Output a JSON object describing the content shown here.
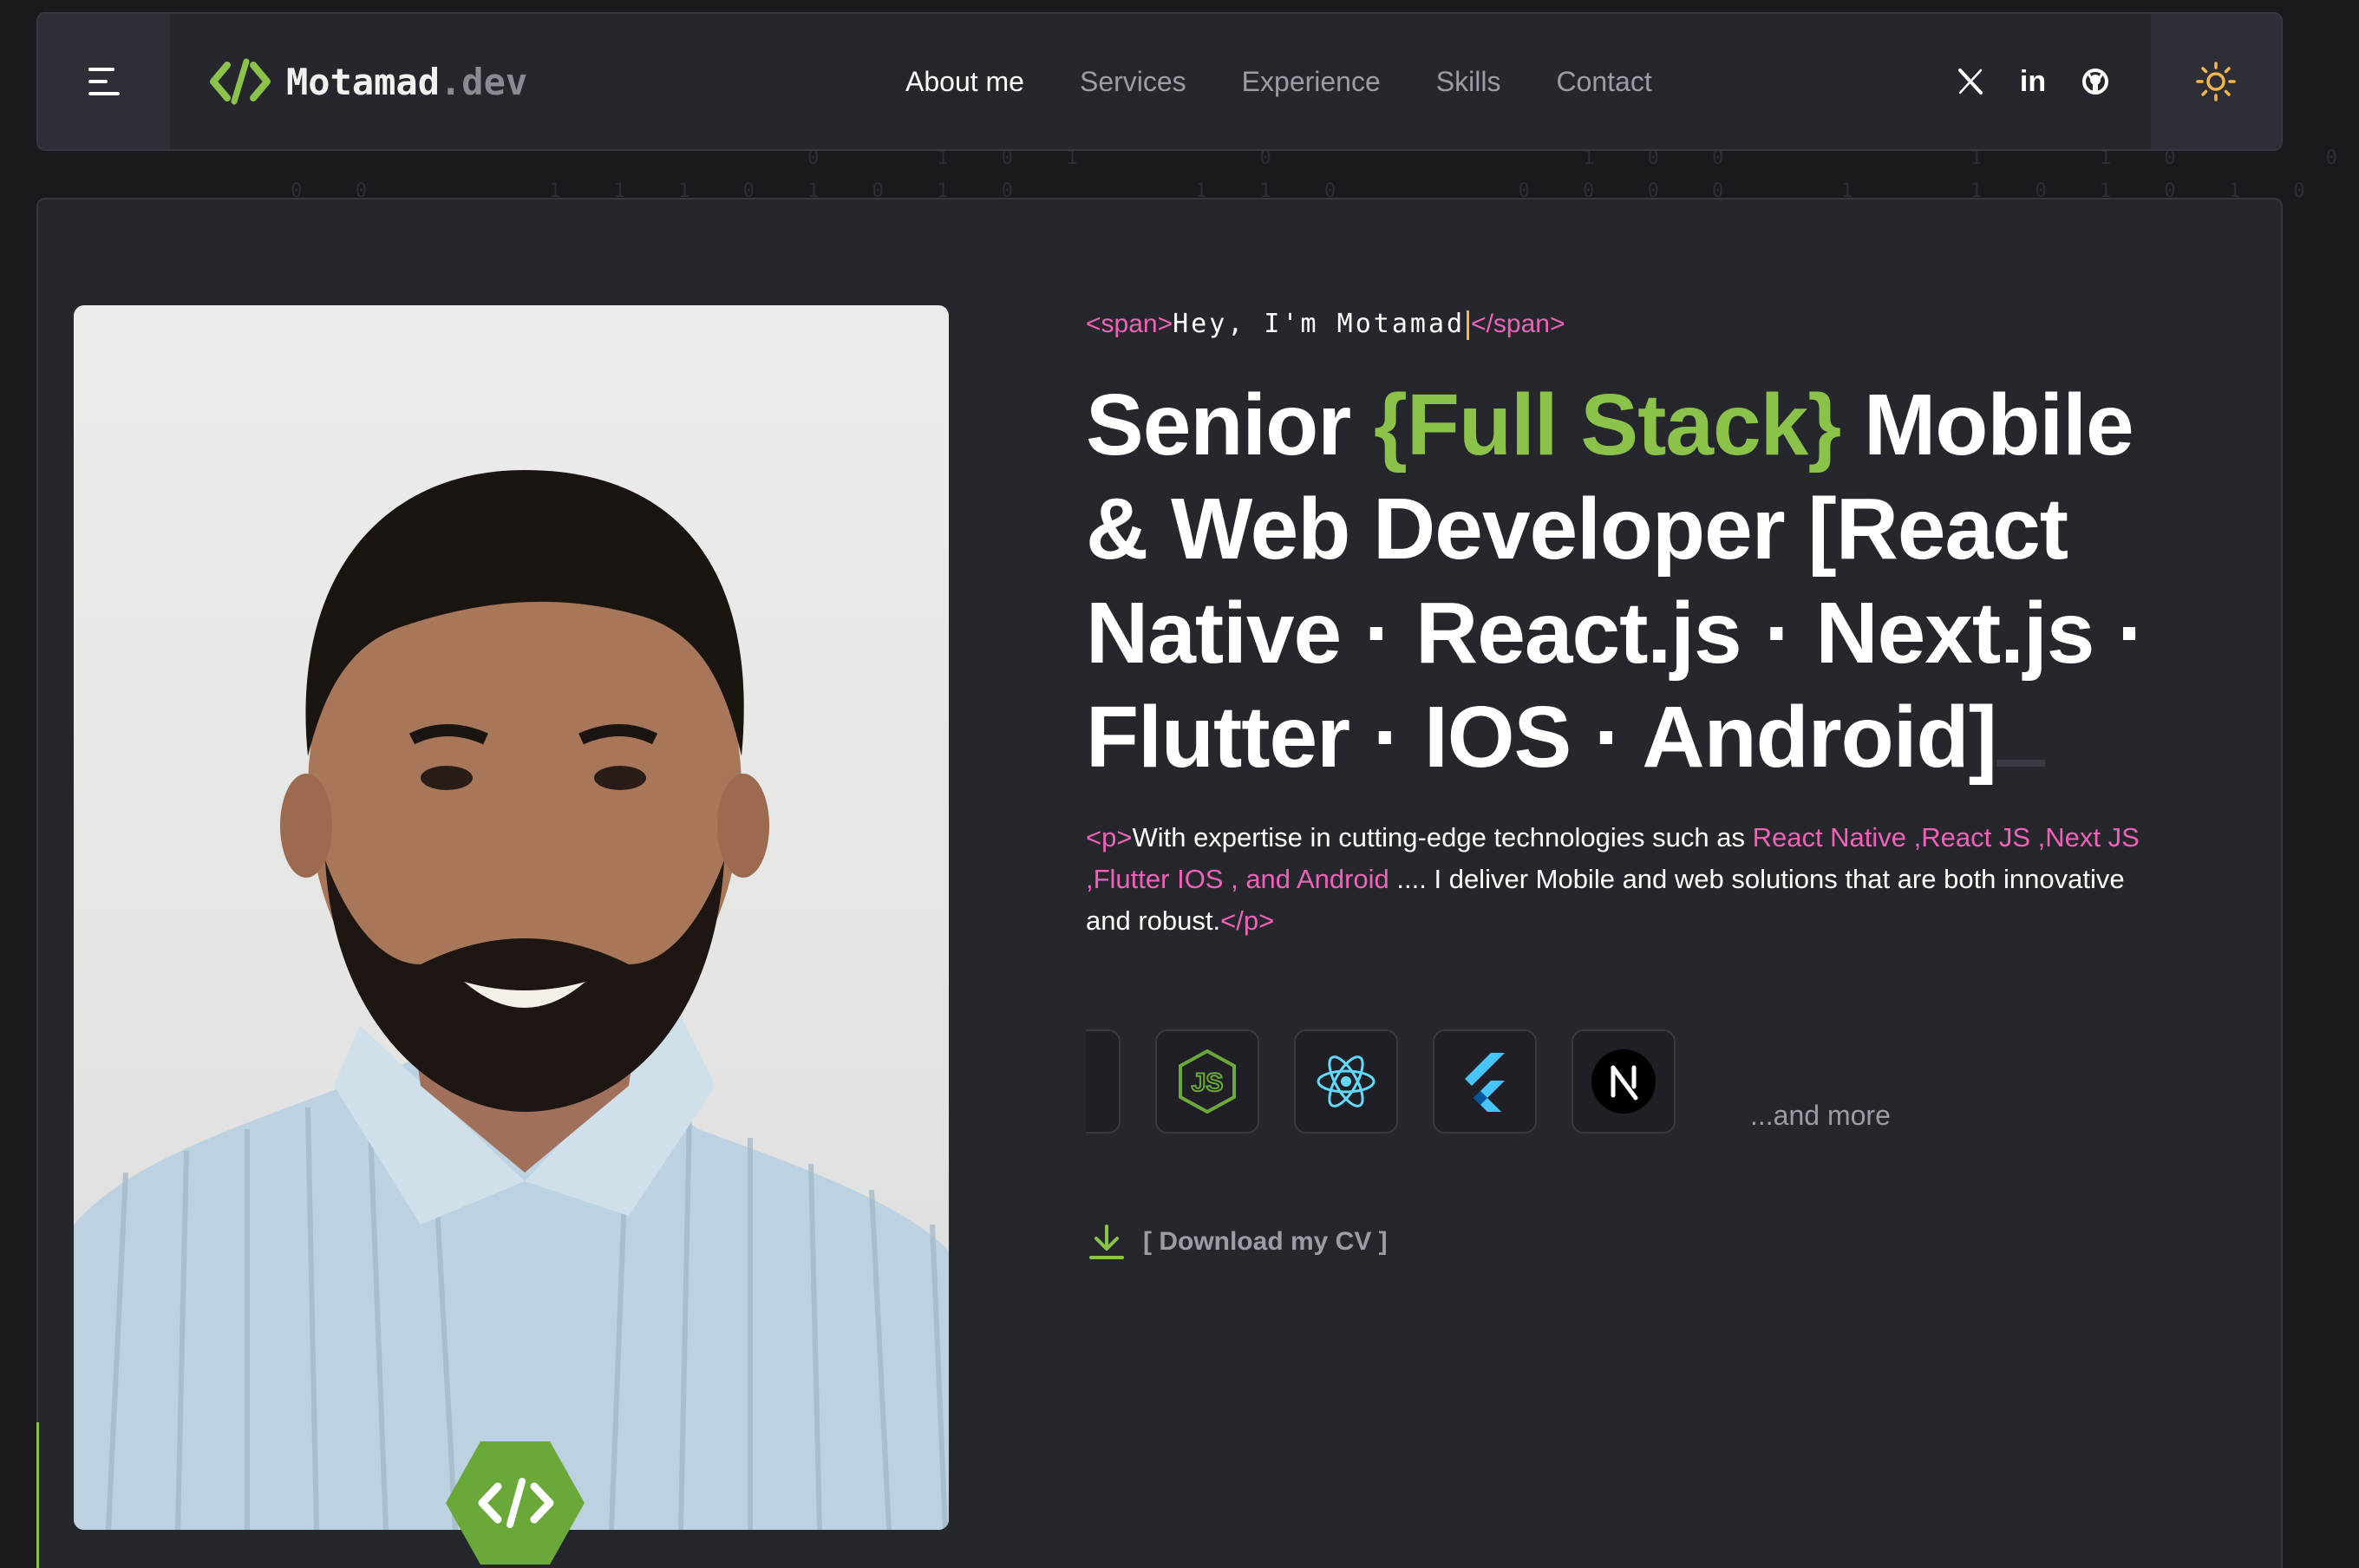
{
  "brand": {
    "name": "Motamad",
    "tld": ".dev",
    "accent_color": "#8bc34a",
    "logo_icon": "code-brackets-icon"
  },
  "nav": {
    "menu_icon": "hamburger-menu-icon",
    "links": [
      {
        "label": "About me",
        "active": true
      },
      {
        "label": "Services",
        "active": false
      },
      {
        "label": "Experience",
        "active": false
      },
      {
        "label": "Skills",
        "active": false
      },
      {
        "label": "Contact",
        "active": false
      }
    ],
    "socials": [
      {
        "icon": "x-twitter-icon"
      },
      {
        "icon": "linkedin-icon",
        "text": "in"
      },
      {
        "icon": "github-icon"
      }
    ],
    "theme_toggle_icon": "sun-icon"
  },
  "hero": {
    "intro_open_tag": "<span>",
    "intro_text": "Hey, I'm Motamad",
    "intro_close_tag": "</span>",
    "headline_before": "Senior ",
    "headline_accent": "{Full Stack}",
    "headline_after": " Mobile & Web Developer [React Native · React.js · Next.js · Flutter · IOS · Android]",
    "desc_open_tag": "<p>",
    "desc_text_1": "With expertise in cutting-edge technologies such as ",
    "desc_highlight": "React Native ,React JS ,Next JS ,Flutter IOS , and Android",
    "desc_text_2": " .... I deliver Mobile and web solutions that are both innovative and robust.",
    "desc_close_tag": "</p>",
    "tech_icons": [
      "nodejs-icon",
      "react-icon",
      "flutter-icon",
      "nextjs-icon"
    ],
    "and_more": "...and more",
    "download_label": "[ Download my CV ]",
    "download_icon": "download-icon",
    "badge_icon": "code-brackets-icon",
    "tag_color": "#f062b8"
  }
}
